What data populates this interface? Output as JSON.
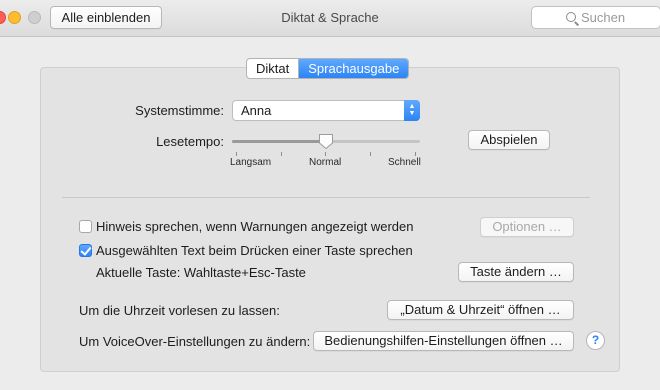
{
  "window": {
    "title": "Diktat & Sprache",
    "show_all_label": "Alle einblenden",
    "search_placeholder": "Suchen"
  },
  "tabs": [
    {
      "label": "Diktat",
      "active": false
    },
    {
      "label": "Sprachausgabe",
      "active": true
    }
  ],
  "voice": {
    "label": "Systemstimme:",
    "selected": "Anna"
  },
  "rate": {
    "label": "Lesetempo:",
    "value": 0.5,
    "min_label": "Langsam",
    "mid_label": "Normal",
    "max_label": "Schnell",
    "play_label": "Abspielen"
  },
  "options": {
    "warn_label": "Hinweis sprechen, wenn Warnungen angezeigt werden",
    "warn_checked": false,
    "options_button": "Optionen …",
    "speak_selection_label": "Ausgewählten Text beim Drücken einer Taste sprechen",
    "speak_selection_checked": true,
    "current_key_label": "Aktuelle Taste: Wahltaste+Esc-Taste",
    "change_key_button": "Taste ändern …",
    "clock_label": "Um die Uhrzeit vorlesen zu lassen:",
    "clock_button": "„Datum & Uhrzeit“ öffnen …",
    "voiceover_label": "Um VoiceOver-Einstellungen zu ändern:",
    "voiceover_button": "Bedienungshilfen-Einstellungen öffnen …",
    "help": "?"
  },
  "colors": {
    "accent": "#2c84f5",
    "close": "#fd5f57",
    "minimize": "#febc2e"
  }
}
